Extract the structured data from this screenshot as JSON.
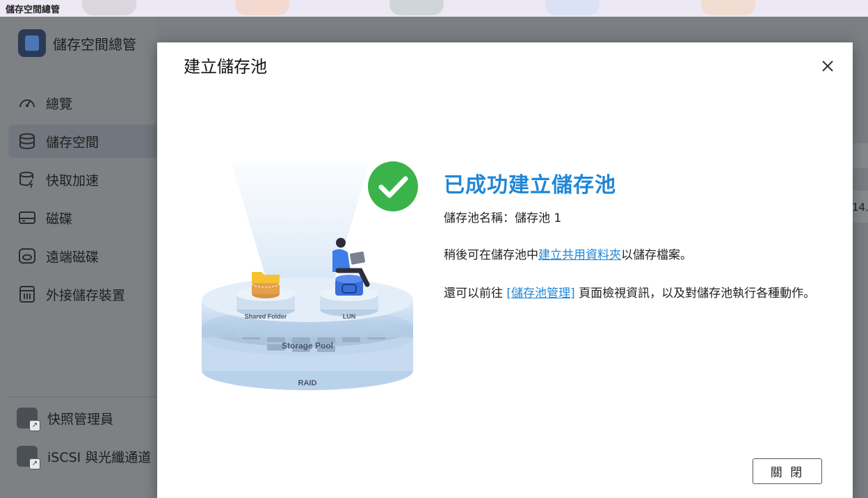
{
  "window": {
    "title": "儲存空間總管"
  },
  "app": {
    "title": "儲存空間總管"
  },
  "sidebar": {
    "items": [
      {
        "label": "總覽",
        "icon": "dashboard-gauge-icon",
        "active": false
      },
      {
        "label": "儲存空間",
        "icon": "database-icon",
        "active": true
      },
      {
        "label": "快取加速",
        "icon": "cache-accelerate-icon",
        "active": false
      },
      {
        "label": "磁碟",
        "icon": "disk-icon",
        "active": false
      },
      {
        "label": "遠端磁碟",
        "icon": "remote-disk-icon",
        "active": false
      },
      {
        "label": "外接儲存裝置",
        "icon": "external-storage-icon",
        "active": false
      }
    ],
    "external_apps": [
      {
        "label": "快照管理員",
        "icon": "snapshot-manager-icon"
      },
      {
        "label": "iSCSI 與光纖通道",
        "icon": "iscsi-fibre-channel-icon"
      }
    ]
  },
  "background": {
    "partial_value": "14."
  },
  "dialog": {
    "title": "建立儲存池",
    "success_title": "已成功建立儲存池",
    "pool_name_label": "儲存池名稱：",
    "pool_name_value": "儲存池 1",
    "line2_prefix": "稍後可在儲存池中",
    "line2_link": "建立共用資料夾",
    "line2_suffix": "以儲存檔案。",
    "line3_prefix": "還可以前往 ",
    "line3_link": "[儲存池管理]",
    "line3_suffix": " 頁面檢視資訊，以及對儲存池執行各種動作。",
    "close_button_label": "關 閉",
    "illustration": {
      "shared_folder_label": "Shared Folder",
      "lun_label": "LUN",
      "storage_pool_label": "Storage Pool",
      "raid_label": "RAID"
    }
  },
  "colors": {
    "accent_blue": "#1f86d6",
    "success_green": "#3ab44a",
    "dim_background": "#7b7e82"
  }
}
